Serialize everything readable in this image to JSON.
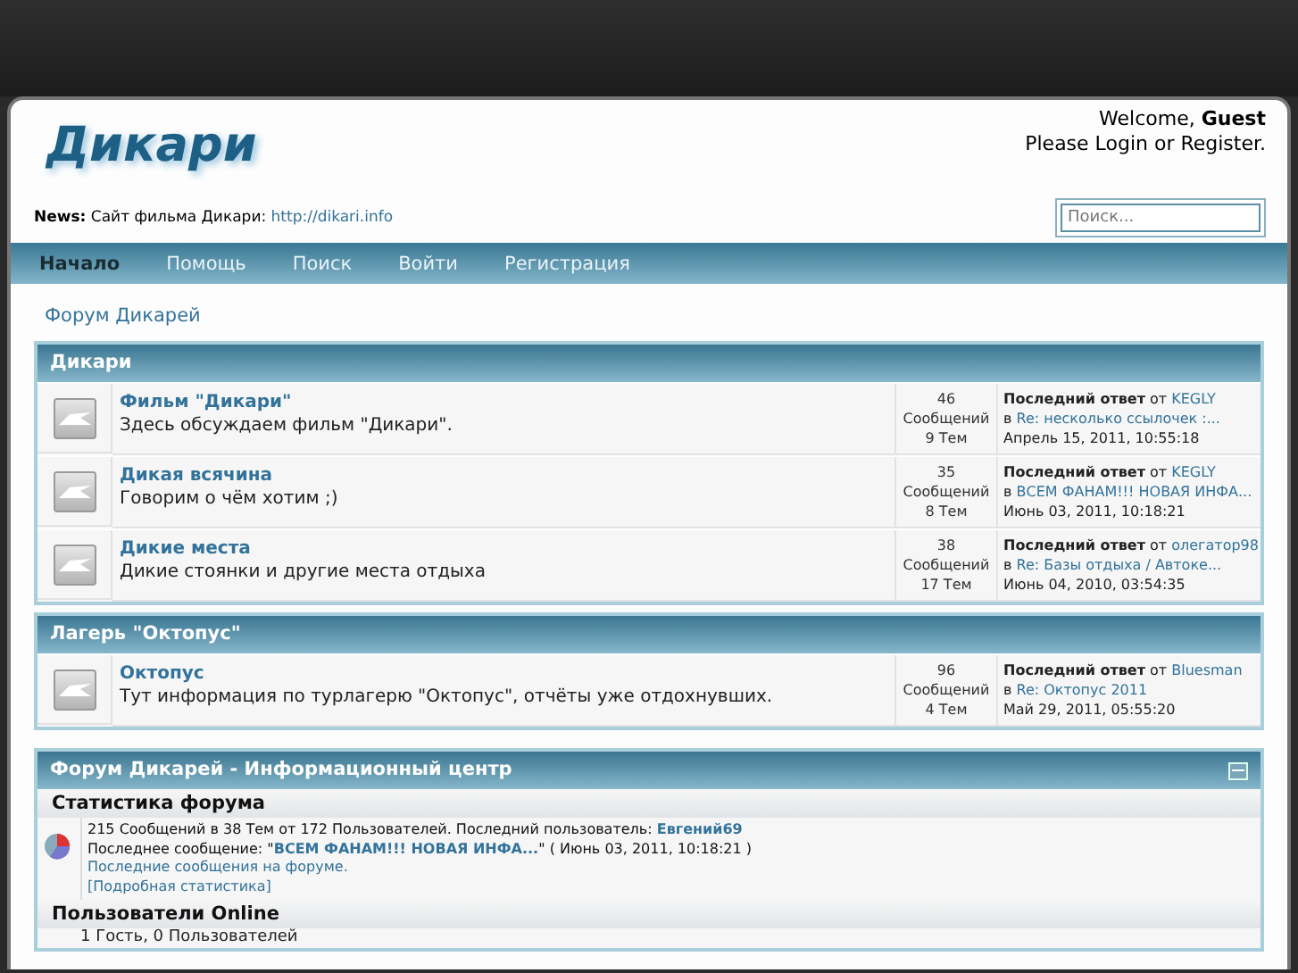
{
  "header": {
    "logo": "Дикари",
    "welcome": "Welcome, **Guest**",
    "login_prompt": "Please Login or Register.",
    "news_label": "News:",
    "news_text": "Сайт фильма Дикари:",
    "news_link": "http://dikari.info",
    "search": {
      "placeholder": "Поиск..."
    }
  },
  "nav": [
    {
      "label": "Начало",
      "selected": true
    },
    {
      "label": "Помощь",
      "selected": false
    },
    {
      "label": "Поиск",
      "selected": false
    },
    {
      "label": "Войти",
      "selected": false
    },
    {
      "label": "Регистрация",
      "selected": false
    }
  ],
  "breadcrumb": "Форум Дикарей",
  "categories": [
    {
      "title": "Дикари",
      "boards": [
        {
          "name": "Фильм \"Дикари\"",
          "description": "Здесь обсуждаем фильм \"Дикари\".",
          "posts": "46",
          "posts_label": "Сообщений",
          "topics": "9 Тем",
          "last_label": "Последний ответ",
          "by": "от",
          "user": "KEGLY",
          "in": "в",
          "topic": "Re: несколько ссылочек :...",
          "date": "Апрель 15, 2011, 10:55:18"
        },
        {
          "name": "Дикая всячина",
          "description": "Говорим о чём хотим ;)",
          "posts": "35",
          "posts_label": "Сообщений",
          "topics": "8 Тем",
          "last_label": "Последний ответ",
          "by": "от",
          "user": "KEGLY",
          "in": "в",
          "topic": "ВСЕМ ФАНАМ!!! НОВАЯ ИНФА...",
          "date": "Июнь 03, 2011, 10:18:21"
        },
        {
          "name": "Дикие места",
          "description": "Дикие стоянки и другие места отдыха",
          "posts": "38",
          "posts_label": "Сообщений",
          "topics": "17 Тем",
          "last_label": "Последний ответ",
          "by": "от",
          "user": "олегатор98",
          "in": "в",
          "topic": "Re: Базы отдыха / Автоке...",
          "date": "Июнь 04, 2010, 03:54:35"
        }
      ]
    },
    {
      "title": "Лагерь \"Октопус\"",
      "boards": [
        {
          "name": "Октопус",
          "description": "Тут информация по турлагерю \"Октопус\", отчёты уже отдохнувших.",
          "posts": "96",
          "posts_label": "Сообщений",
          "topics": "4 Тем",
          "last_label": "Последний ответ",
          "by": "от",
          "user": "Bluesman",
          "in": "в",
          "topic": "Re: Октопус 2011",
          "date": "Май 29, 2011, 05:55:20"
        }
      ]
    }
  ],
  "info_center": {
    "title": "Форум Дикарей - Информационный центр",
    "collapsed": false,
    "stats_title": "Статистика форума",
    "stats_text": "215 Сообщений в 38 Тем от 172 Пользователей. Последний пользователь:",
    "latest_member": "Евгений69",
    "last_post_label": "Последнее сообщение: \"",
    "last_post_link": "ВСЕМ ФАНАМ!!! НОВАЯ ИНФА...",
    "last_post_date": "\" ( Июнь 03, 2011, 10:18:21 )",
    "recent_link": "Последние сообщения на форуме.",
    "detailed_link": "[Подробная статистика]",
    "online_title": "Пользователи Online",
    "online_text": "1 Гость, 0 Пользователей"
  }
}
